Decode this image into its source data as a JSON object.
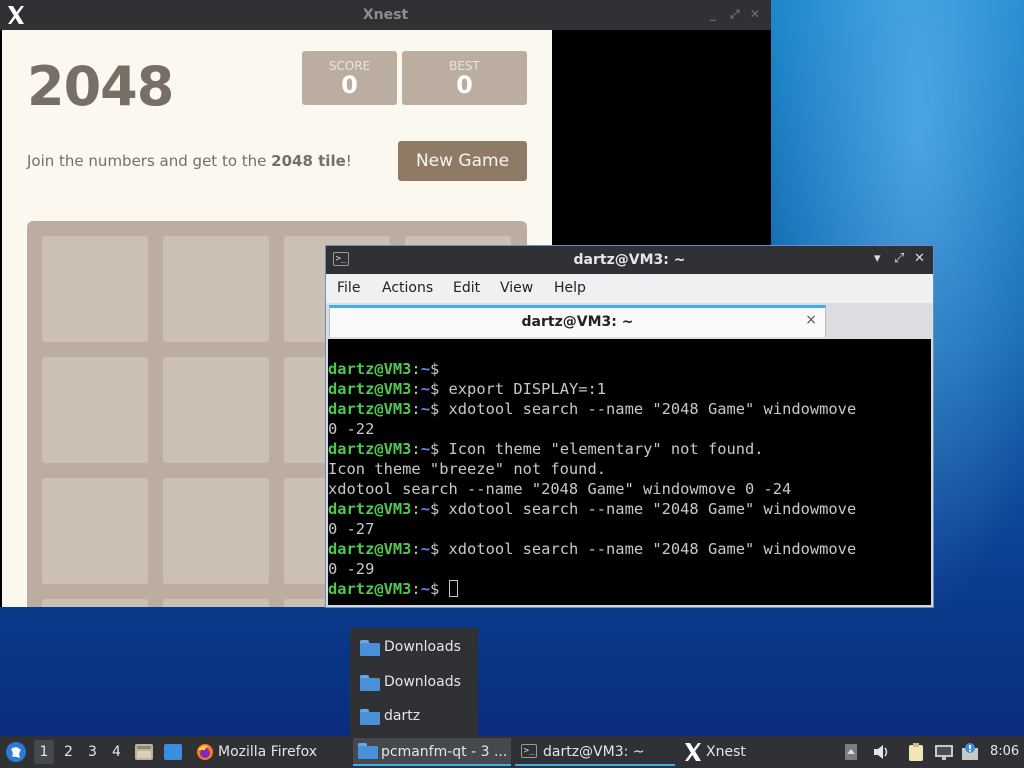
{
  "xnest": {
    "title": "Xnest",
    "controls": [
      "_",
      "⤢",
      "✕"
    ]
  },
  "game": {
    "title": "2048",
    "score_label": "SCORE",
    "score_value": "0",
    "best_label": "BEST",
    "best_value": "0",
    "intro_prefix": "Join the numbers and get to the ",
    "intro_bold": "2048 tile",
    "intro_suffix": "!",
    "new_game_label": "New Game",
    "tile_color": "#bbada0",
    "button_color": "#8f7a66"
  },
  "terminal": {
    "title": "dartz@VM3: ~",
    "menu": [
      "File",
      "Actions",
      "Edit",
      "View",
      "Help"
    ],
    "tab_label": "dartz@VM3: ~",
    "tab_close": "×",
    "prompt_user": "dartz@VM3",
    "prompt_sep": ":",
    "prompt_path": "~",
    "prompt_end": "$",
    "lines": [
      {
        "prompt": true,
        "text": ""
      },
      {
        "prompt": true,
        "text": " export DISPLAY=:1"
      },
      {
        "prompt": true,
        "text": " xdotool search --name \"2048 Game\" windowmove"
      },
      {
        "prompt": false,
        "text": "0 -22"
      },
      {
        "prompt": true,
        "text": " Icon theme \"elementary\" not found."
      },
      {
        "prompt": false,
        "text": "Icon theme \"breeze\" not found."
      },
      {
        "prompt": false,
        "text": "xdotool search --name \"2048 Game\" windowmove 0 -24"
      },
      {
        "prompt": true,
        "text": " xdotool search --name \"2048 Game\" windowmove"
      },
      {
        "prompt": false,
        "text": "0 -27"
      },
      {
        "prompt": true,
        "text": " xdotool search --name \"2048 Game\" windowmove"
      },
      {
        "prompt": false,
        "text": "0 -29"
      },
      {
        "prompt": true,
        "text": " ",
        "cursor": true
      }
    ],
    "prompt_user_color": "#4ec94e",
    "prompt_path_color": "#5c8ef0"
  },
  "popup": {
    "items": [
      "Downloads",
      "Downloads",
      "dartz"
    ]
  },
  "taskbar": {
    "workspaces": [
      "1",
      "2",
      "3",
      "4"
    ],
    "tasks": [
      {
        "label": "Mozilla Firefox",
        "icon": "firefox-icon"
      },
      {
        "label": "pcmanfm-qt - 3 ...",
        "icon": "folder-icon"
      },
      {
        "label": "dartz@VM3: ~",
        "icon": "terminal-icon"
      },
      {
        "label": "Xnest",
        "icon": "x-icon"
      }
    ],
    "clock": "8:06"
  }
}
